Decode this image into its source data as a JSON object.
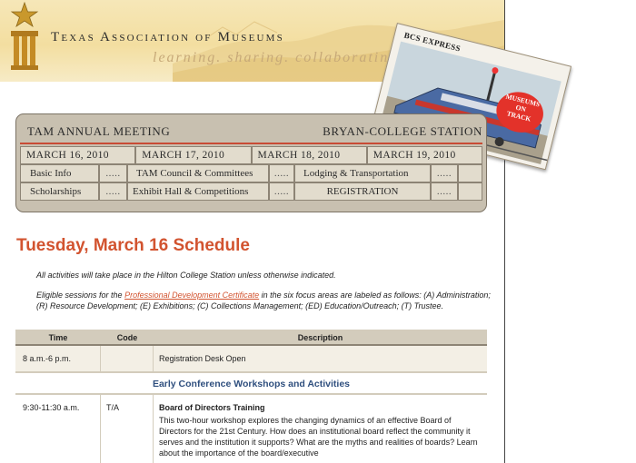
{
  "header": {
    "org_name": "Texas Association of Museums",
    "tagline": "learning. sharing. collaborating",
    "logo_icon": "star-column-logo-icon"
  },
  "ticket": {
    "title": "BCS EXPRESS",
    "badge": [
      "MUSEUMS",
      "ON",
      "TRACK"
    ],
    "image_icon": "train-locomotive-icon"
  },
  "meeting": {
    "title": "TAM ANNUAL MEETING",
    "location": "BRYAN-COLLEGE STATION",
    "dates": [
      "MARCH 16, 2010",
      "MARCH 17, 2010",
      "MARCH 18, 2010",
      "MARCH 19, 2010"
    ],
    "nav_row_1": [
      "Basic Info",
      "TAM Council & Committees",
      "Lodging & Transportation"
    ],
    "nav_row_2": [
      "Scholarships",
      "Exhibit Hall & Competitions",
      "REGISTRATION"
    ],
    "dots": "....."
  },
  "page": {
    "title": "Tuesday, March 16 Schedule",
    "intro_1": "All activities will take place in the Hilton College Station unless otherwise indicated.",
    "intro_2_pre": "Eligible sessions for the ",
    "intro_2_link": "Professional Development Certificate",
    "intro_2_post": " in the six focus areas are labeled as follows: (A) Administration; (R) Resource Development; (E) Exhibitions; (C) Collections Management; (ED) Education/Outreach; (T) Trustee."
  },
  "schedule": {
    "headers": [
      "Time",
      "Code",
      "Description"
    ],
    "row_1": {
      "time": "8 a.m.-6 p.m.",
      "code": "",
      "description": "Registration Desk Open"
    },
    "section_1": "Early Conference Workshops and Activities",
    "row_2": {
      "time": "9:30-11:30 a.m.",
      "code": "T/A",
      "title": "Board of Directors Training",
      "description": "This two-hour workshop explores the changing dynamics of an effective Board of Directors for the 21st Century. How does an institutional board reflect the community it serves and the institution it supports? What are the myths and realities of boards? Learn about the importance of the board/executive"
    }
  },
  "colors": {
    "accent": "#d2532f",
    "panel": "#c8c0b0",
    "section_blue": "#2f4f7e",
    "banner": "#f3dea0"
  }
}
